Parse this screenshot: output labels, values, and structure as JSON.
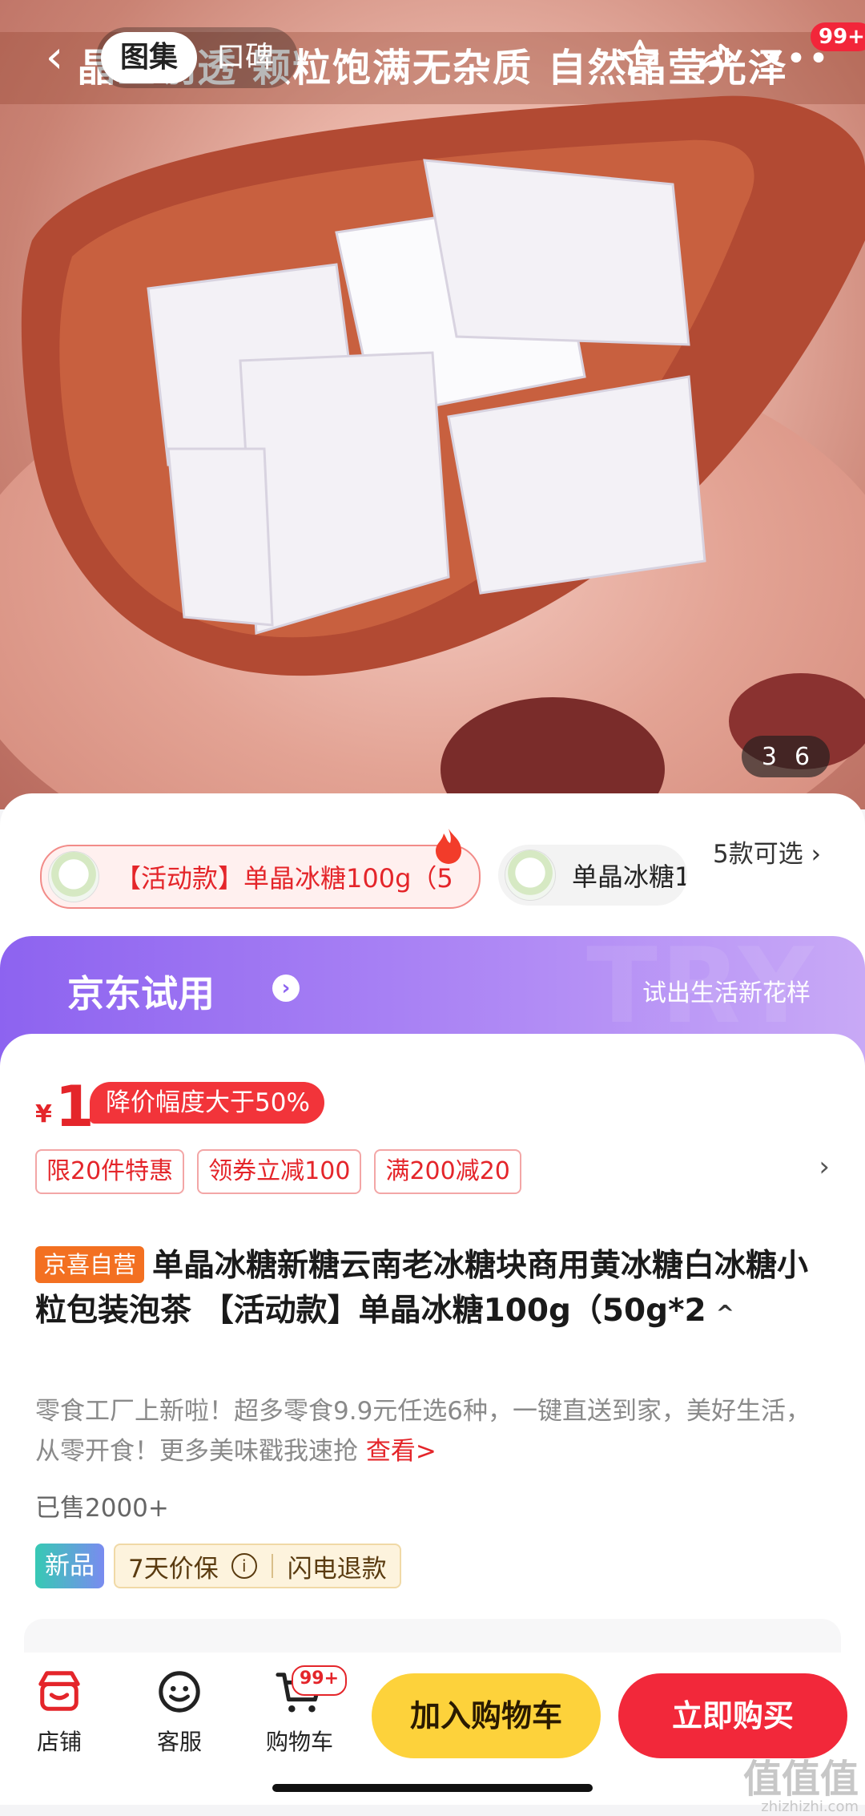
{
  "hero": {
    "banner_text": "晶莹剔透 颗粒饱满无杂质 自然晶莹光泽",
    "image_index": "3",
    "image_total": "6"
  },
  "nav": {
    "tabs": [
      {
        "label": "图集",
        "active": true
      },
      {
        "label": "口碑",
        "active": false
      }
    ],
    "icons": [
      "back-icon",
      "star-icon",
      "share-icon",
      "more-icon"
    ],
    "more_badge": "99+"
  },
  "variants": {
    "items": [
      {
        "label": "【活动款】单晶冰糖100g（5",
        "selected": true
      },
      {
        "label": "单晶冰糖1",
        "selected": false
      }
    ],
    "more_label": "5款可选 ›"
  },
  "trial": {
    "title": "京东试用",
    "slogan": "试出生活新花样",
    "watermark": "TRY"
  },
  "price": {
    "currency": "¥",
    "value": "1",
    "discount_tag": "降价幅度大于50%",
    "promos": [
      "限20件特惠",
      "领券立减100",
      "满200减20"
    ]
  },
  "product": {
    "self_tag": "京喜自营",
    "title": "单晶冰糖新糖云南老冰糖块商用黄冰糖白冰糖小粒包装泡茶 【活动款】单晶冰糖100g（50g*2",
    "description": "零食工厂上新啦！超多零食9.9元任选6种，一键直送到家，美好生活，从零开食！更多美味戳我速抢 ",
    "description_link": "查看>",
    "sold": "已售2000+",
    "new_tag": "新品",
    "price_guard": "7天价保",
    "refund": "闪电退款"
  },
  "bottom": {
    "store": "店铺",
    "service": "客服",
    "cart": "购物车",
    "cart_badge": "99+",
    "add_to_cart": "加入购物车",
    "buy_now": "立即购买"
  },
  "watermark": {
    "main": "值值值",
    "sub": "zhizhizhi.com"
  },
  "colors": {
    "accent_red": "#e4252a",
    "trial_purple": "#8d63f0",
    "cart_yellow": "#fdd23b",
    "buy_red": "#f2283a"
  }
}
